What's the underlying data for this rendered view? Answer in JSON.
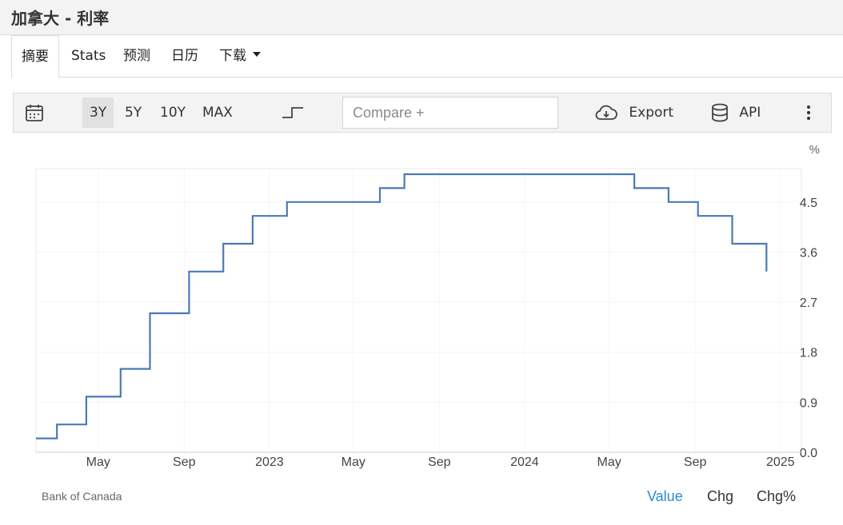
{
  "page_title": "加拿大 - 利率",
  "tabs": [
    {
      "label": "摘要",
      "active": true
    },
    {
      "label": "Stats"
    },
    {
      "label": "预测"
    },
    {
      "label": "日历"
    },
    {
      "label": "下载"
    }
  ],
  "toolbar": {
    "ranges": [
      "3Y",
      "5Y",
      "10Y",
      "MAX"
    ],
    "active_range": "3Y",
    "compare_placeholder": "Compare +",
    "export_label": "Export",
    "api_label": "API"
  },
  "chart_data": {
    "type": "line",
    "step": true,
    "unit_label": "%",
    "ylim": [
      0,
      5.1
    ],
    "y_ticks": [
      0.0,
      0.9,
      1.8,
      2.7,
      3.6,
      4.5
    ],
    "y_tick_labels": [
      "0.0",
      "0.9",
      "1.8",
      "2.7",
      "3.6",
      "4.5"
    ],
    "xlim": [
      "2022-02-01",
      "2025-01-31"
    ],
    "x_ticks": [
      "2022-05-01",
      "2022-09-01",
      "2023-01-01",
      "2023-05-01",
      "2023-09-01",
      "2024-01-01",
      "2024-05-01",
      "2024-09-01",
      "2025-01-01"
    ],
    "x_tick_labels": [
      "May",
      "Sep",
      "2023",
      "May",
      "Sep",
      "2024",
      "May",
      "Sep",
      "2025"
    ],
    "grid": true,
    "line_color": "#4a7ab8",
    "points": [
      {
        "date": "2022-02-01",
        "value": 0.25
      },
      {
        "date": "2022-03-03",
        "value": 0.5
      },
      {
        "date": "2022-04-14",
        "value": 1.0
      },
      {
        "date": "2022-06-02",
        "value": 1.5
      },
      {
        "date": "2022-07-14",
        "value": 2.5
      },
      {
        "date": "2022-09-08",
        "value": 3.25
      },
      {
        "date": "2022-10-27",
        "value": 3.75
      },
      {
        "date": "2022-12-08",
        "value": 4.25
      },
      {
        "date": "2023-01-26",
        "value": 4.5
      },
      {
        "date": "2023-06-08",
        "value": 4.75
      },
      {
        "date": "2023-07-13",
        "value": 5.0
      },
      {
        "date": "2024-06-06",
        "value": 4.75
      },
      {
        "date": "2024-07-25",
        "value": 4.5
      },
      {
        "date": "2024-09-05",
        "value": 4.25
      },
      {
        "date": "2024-10-24",
        "value": 3.75
      },
      {
        "date": "2024-12-12",
        "value": 3.25
      }
    ],
    "source": "Bank of Canada"
  },
  "value_tabs": [
    {
      "label": "Value",
      "active": true
    },
    {
      "label": "Chg"
    },
    {
      "label": "Chg%"
    }
  ],
  "colors": {
    "accent": "#2a8ad8",
    "line": "#4a7ab8"
  }
}
